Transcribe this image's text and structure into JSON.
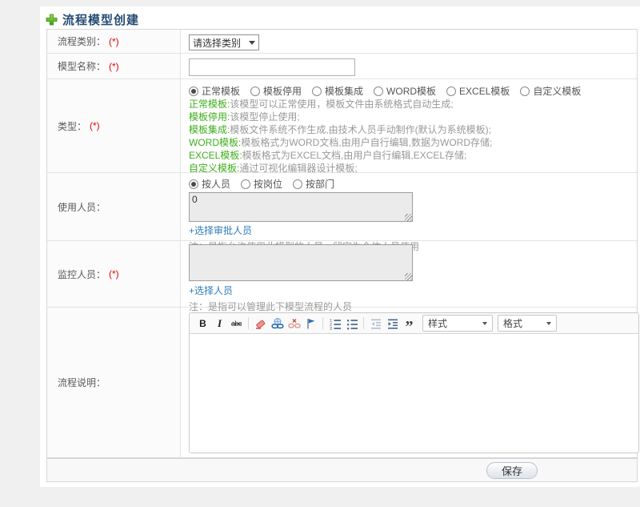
{
  "header": {
    "title": "流程模型创建"
  },
  "fields": {
    "category": {
      "label": "流程类别：",
      "required": "(*)",
      "selected_option": "请选择类别"
    },
    "model_name": {
      "label": "模型名称：",
      "required": "(*)",
      "value": ""
    },
    "type": {
      "label": "类型：",
      "required": "(*)",
      "options": [
        "正常模板",
        "模板停用",
        "模板集成",
        "WORD模板",
        "EXCEL模板",
        "自定义模板"
      ],
      "selected_option": "正常模板",
      "descriptions": [
        {
          "term": "正常模板:",
          "text": "该模型可以正常使用，模板文件由系统格式自动生成;"
        },
        {
          "term": "模板停用:",
          "text": "该模型停止使用;"
        },
        {
          "term": "模板集成:",
          "text": "模板文件系统不作生成,由技术人员手动制作(默认为系统模板);"
        },
        {
          "term": "WORD模板:",
          "text": "模板格式为WORD文档,由用户自行编辑,数据为WORD存储;"
        },
        {
          "term": "EXCEL模板:",
          "text": "模板格式为EXCEL文档,由用户自行编辑,EXCEL存储;"
        },
        {
          "term": "自定义模板:",
          "text": "通过可视化编辑器设计模板;"
        }
      ]
    },
    "users": {
      "label": "使用人员：",
      "options": [
        "按人员",
        "按岗位",
        "按部门"
      ],
      "selected_option": "按人员",
      "textarea_value": "0",
      "link": "+选择审批人员",
      "note": "注：是指允许使用此模型的人员，留空为全体人员使用"
    },
    "monitors": {
      "label": "监控人员：",
      "required": "(*)",
      "textarea_value": "",
      "link": "+选择人员",
      "note": "注：是指可以管理此下模型流程的人员"
    },
    "description": {
      "label": "流程说明："
    }
  },
  "editor": {
    "styles_label": "样式",
    "format_label": "格式",
    "glyphs": {
      "bold": "B",
      "italic": "I",
      "strikethrough": "abc",
      "blockquote": "”"
    },
    "icons": [
      "bold-icon",
      "italic-icon",
      "strikethrough-icon",
      "remove-format-icon",
      "link-icon",
      "unlink-icon",
      "flag-icon",
      "ordered-list-icon",
      "unordered-list-icon",
      "outdent-icon",
      "indent-icon",
      "blockquote-icon"
    ]
  },
  "footer": {
    "save_label": "保存"
  },
  "colors": {
    "accent_green": "#3fae1e",
    "link_blue": "#2e7cb8",
    "required_red": "#e60000",
    "title_navy": "#254b73"
  }
}
